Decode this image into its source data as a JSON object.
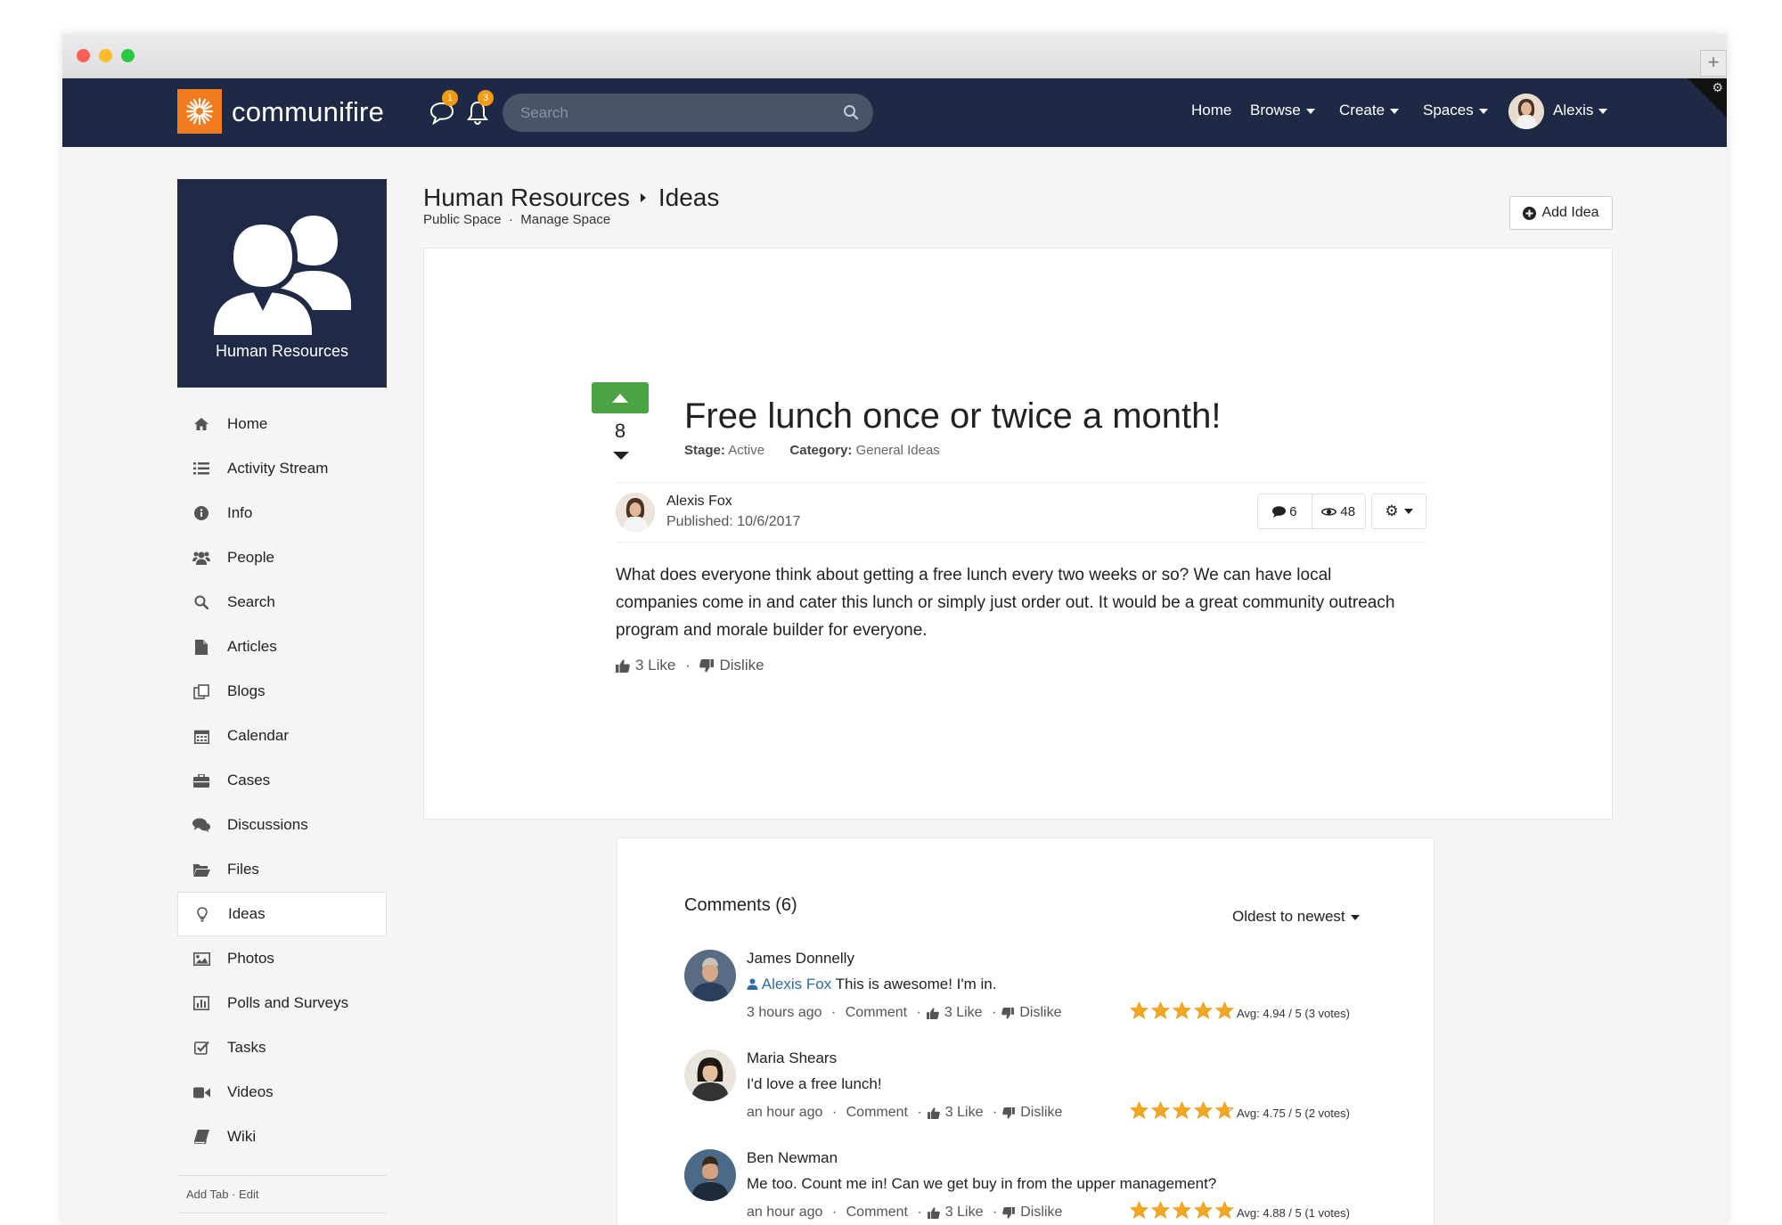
{
  "brand": {
    "name": "communifire",
    "accent": "#f47c20",
    "nav_bg": "#1e2a45"
  },
  "topnav": {
    "messages_badge": "1",
    "notifications_badge": "3",
    "search_placeholder": "Search",
    "menu": [
      "Home",
      "Browse",
      "Create",
      "Spaces"
    ],
    "user": "Alexis"
  },
  "space": {
    "name": "Human Resources",
    "section": "Ideas",
    "public_label": "Public Space",
    "manage_label": "Manage Space",
    "add_button": "Add Idea"
  },
  "sidebar": {
    "items": [
      {
        "label": "Home",
        "icon": "home-icon"
      },
      {
        "label": "Activity Stream",
        "icon": "list-icon"
      },
      {
        "label": "Info",
        "icon": "info-icon"
      },
      {
        "label": "People",
        "icon": "users-icon"
      },
      {
        "label": "Search",
        "icon": "search-icon"
      },
      {
        "label": "Articles",
        "icon": "file-icon"
      },
      {
        "label": "Blogs",
        "icon": "blog-icon"
      },
      {
        "label": "Calendar",
        "icon": "calendar-icon"
      },
      {
        "label": "Cases",
        "icon": "briefcase-icon"
      },
      {
        "label": "Discussions",
        "icon": "chat-icon"
      },
      {
        "label": "Files",
        "icon": "folder-icon"
      },
      {
        "label": "Ideas",
        "icon": "lightbulb-icon",
        "active": true
      },
      {
        "label": "Photos",
        "icon": "image-icon"
      },
      {
        "label": "Polls and Surveys",
        "icon": "chart-icon"
      },
      {
        "label": "Tasks",
        "icon": "checkbox-icon"
      },
      {
        "label": "Videos",
        "icon": "video-icon"
      },
      {
        "label": "Wiki",
        "icon": "book-icon"
      }
    ],
    "footer_add": "Add Tab",
    "footer_edit": "Edit"
  },
  "idea": {
    "votes": "8",
    "title": "Free lunch once or twice a month!",
    "stage_label": "Stage:",
    "stage": "Active",
    "category_label": "Category:",
    "category": "General Ideas",
    "author": "Alexis Fox",
    "published": "Published: 10/6/2017",
    "comments_count": "6",
    "views_count": "48",
    "body": "What does everyone think about getting a free lunch every two weeks or so? We can have local companies come in and cater this lunch or simply just order out. It would be a great community outreach program and morale builder for everyone.",
    "like_label": "3 Like",
    "dislike_label": "Dislike"
  },
  "comments": {
    "title": "Comments (6)",
    "sort": "Oldest to newest",
    "comment_label": "Comment",
    "items": [
      {
        "name": "James Donnelly",
        "mention": "Alexis Fox",
        "text": "This is awesome! I'm in.",
        "time": "3 hours ago",
        "likes": "3 Like",
        "dislike": "Dislike",
        "rating": 4.94,
        "avg": "Avg: 4.94 / 5 (3 votes)"
      },
      {
        "name": "Maria Shears",
        "mention": "",
        "text": "I'd love a free lunch!",
        "time": "an hour ago",
        "likes": "3 Like",
        "dislike": "Dislike",
        "rating": 4.75,
        "avg": "Avg: 4.75 / 5 (2 votes)"
      },
      {
        "name": "Ben Newman",
        "mention": "",
        "text": "Me too. Count me in! Can we get buy in from the upper management?",
        "time": "an hour ago",
        "likes": "3 Like",
        "dislike": "Dislike",
        "rating": 4.88,
        "avg": "Avg: 4.88 / 5 (1 votes)"
      }
    ]
  }
}
